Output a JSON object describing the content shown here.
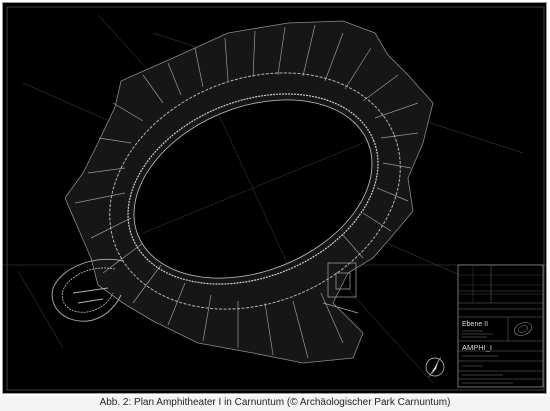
{
  "caption": "Abb. 2: Plan Amphitheater I in Carnuntum (© Archäologischer Park Carnuntum)",
  "title_block": {
    "level": "Ebene II",
    "drawing_code": "AMPHI_I"
  },
  "colors": {
    "background": "#000000",
    "linework": "#bfbfbf",
    "frame": "#9a9a9a",
    "caption_text": "#222222"
  },
  "icons": [
    "north-arrow-icon"
  ]
}
